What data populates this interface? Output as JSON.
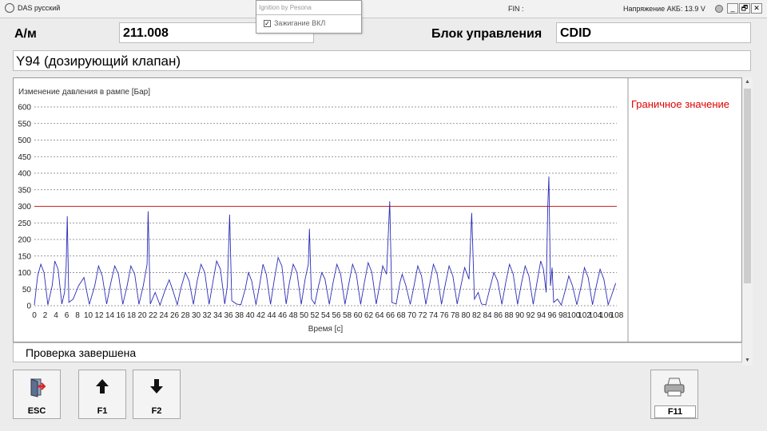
{
  "titlebar": {
    "app_title": "DAS русский",
    "fin_label": "FIN :",
    "voltage_label": "Напряжение АКБ: 13.9 V",
    "minimize_glyph": "_",
    "restore_glyph": "🗗",
    "close_glyph": "✕"
  },
  "popup": {
    "title": "Ignition by Pesona",
    "checkbox_mark": "✓",
    "checkbox_label": "Зажигание ВКЛ"
  },
  "header": {
    "am_label": "А/м",
    "am_value": "211.008",
    "ecu_label": "Блок управления",
    "ecu_value": "CDID"
  },
  "component": "Y94 (дозирующий клапан)",
  "legend_label": "Граничное значение",
  "colors": {
    "series": "#2b2bb8",
    "limit": "#cc2222",
    "legend": "#e00000"
  },
  "status_text": "Проверка завершена",
  "scrollbar": {
    "up_glyph": "▲",
    "down_glyph": "▼"
  },
  "buttons": [
    {
      "label": "ESC",
      "icon": "door-exit-icon"
    },
    {
      "label": "F1",
      "icon": "arrow-up-icon",
      "glyph": "🡅"
    },
    {
      "label": "F2",
      "icon": "arrow-down-icon",
      "glyph": "🡇"
    },
    {
      "label": "F11",
      "icon": "printer-icon"
    }
  ],
  "chart_data": {
    "type": "line",
    "title": "Изменение давления в рампе [Бар]",
    "xlabel": "Время [с]",
    "ylabel": "",
    "xlim": [
      0,
      108
    ],
    "ylim": [
      0,
      600
    ],
    "y_ticks": [
      0,
      50,
      100,
      150,
      200,
      250,
      300,
      350,
      400,
      450,
      500,
      550,
      600
    ],
    "x_ticks": [
      0,
      2,
      4,
      6,
      8,
      10,
      12,
      14,
      16,
      18,
      20,
      22,
      24,
      26,
      28,
      30,
      32,
      34,
      36,
      38,
      40,
      42,
      44,
      46,
      48,
      50,
      52,
      54,
      56,
      58,
      60,
      62,
      64,
      66,
      68,
      70,
      72,
      74,
      76,
      78,
      80,
      82,
      84,
      86,
      88,
      90,
      92,
      94,
      96,
      98,
      100,
      102,
      104,
      106,
      108
    ],
    "grid": "horizontal dashed",
    "limit_line": {
      "name": "Граничное значение",
      "value": 300
    },
    "series": [
      {
        "values": [
          [
            0,
            2
          ],
          [
            0.6,
            90
          ],
          [
            1.2,
            125
          ],
          [
            1.8,
            100
          ],
          [
            2.5,
            3
          ],
          [
            3.3,
            60
          ],
          [
            3.8,
            135
          ],
          [
            4.4,
            110
          ],
          [
            5.1,
            5
          ],
          [
            5.6,
            40
          ],
          [
            5.9,
            120
          ],
          [
            6.1,
            270
          ],
          [
            6.4,
            10
          ],
          [
            7.2,
            20
          ],
          [
            8.2,
            60
          ],
          [
            9.2,
            85
          ],
          [
            10.2,
            4
          ],
          [
            11.2,
            60
          ],
          [
            11.9,
            120
          ],
          [
            12.6,
            90
          ],
          [
            13.4,
            5
          ],
          [
            14.2,
            70
          ],
          [
            14.9,
            120
          ],
          [
            15.6,
            95
          ],
          [
            16.4,
            4
          ],
          [
            17.2,
            60
          ],
          [
            17.9,
            120
          ],
          [
            18.6,
            95
          ],
          [
            19.4,
            4
          ],
          [
            20.2,
            60
          ],
          [
            20.9,
            125
          ],
          [
            21.1,
            285
          ],
          [
            21.5,
            5
          ],
          [
            22.4,
            40
          ],
          [
            23.3,
            2
          ],
          [
            24.3,
            50
          ],
          [
            25.0,
            78
          ],
          [
            25.7,
            45
          ],
          [
            26.5,
            3
          ],
          [
            27.2,
            55
          ],
          [
            28.0,
            100
          ],
          [
            28.7,
            75
          ],
          [
            29.5,
            4
          ],
          [
            30.2,
            75
          ],
          [
            30.9,
            125
          ],
          [
            31.6,
            100
          ],
          [
            32.4,
            4
          ],
          [
            33.1,
            70
          ],
          [
            33.8,
            135
          ],
          [
            34.5,
            110
          ],
          [
            35.3,
            5
          ],
          [
            35.8,
            60
          ],
          [
            36.2,
            275
          ],
          [
            36.6,
            15
          ],
          [
            37.5,
            5
          ],
          [
            38.3,
            3
          ],
          [
            39.1,
            50
          ],
          [
            39.7,
            100
          ],
          [
            40.3,
            75
          ],
          [
            41.1,
            3
          ],
          [
            41.8,
            65
          ],
          [
            42.4,
            125
          ],
          [
            43.0,
            95
          ],
          [
            43.8,
            4
          ],
          [
            44.5,
            80
          ],
          [
            45.2,
            145
          ],
          [
            45.9,
            120
          ],
          [
            46.7,
            5
          ],
          [
            47.3,
            70
          ],
          [
            48.0,
            125
          ],
          [
            48.7,
            100
          ],
          [
            49.5,
            4
          ],
          [
            50.2,
            80
          ],
          [
            50.8,
            125
          ],
          [
            51.0,
            232
          ],
          [
            51.4,
            20
          ],
          [
            52.0,
            5
          ],
          [
            52.7,
            60
          ],
          [
            53.3,
            100
          ],
          [
            53.9,
            80
          ],
          [
            54.7,
            4
          ],
          [
            55.4,
            70
          ],
          [
            56.1,
            125
          ],
          [
            56.8,
            95
          ],
          [
            57.6,
            4
          ],
          [
            58.3,
            65
          ],
          [
            59.0,
            125
          ],
          [
            59.7,
            95
          ],
          [
            60.5,
            4
          ],
          [
            61.2,
            70
          ],
          [
            61.9,
            130
          ],
          [
            62.6,
            100
          ],
          [
            63.4,
            5
          ],
          [
            64.0,
            60
          ],
          [
            64.6,
            120
          ],
          [
            65.3,
            95
          ],
          [
            65.9,
            315
          ],
          [
            66.3,
            10
          ],
          [
            67.1,
            5
          ],
          [
            67.8,
            70
          ],
          [
            68.2,
            95
          ],
          [
            68.9,
            60
          ],
          [
            69.7,
            4
          ],
          [
            70.4,
            60
          ],
          [
            71.1,
            120
          ],
          [
            71.8,
            90
          ],
          [
            72.6,
            4
          ],
          [
            73.3,
            65
          ],
          [
            74.0,
            125
          ],
          [
            74.7,
            95
          ],
          [
            75.5,
            4
          ],
          [
            76.2,
            65
          ],
          [
            76.9,
            120
          ],
          [
            77.6,
            90
          ],
          [
            78.4,
            5
          ],
          [
            79.1,
            60
          ],
          [
            79.8,
            115
          ],
          [
            80.6,
            80
          ],
          [
            81.1,
            280
          ],
          [
            81.6,
            20
          ],
          [
            82.3,
            40
          ],
          [
            82.9,
            5
          ],
          [
            83.7,
            3
          ],
          [
            84.5,
            55
          ],
          [
            85.2,
            100
          ],
          [
            85.9,
            75
          ],
          [
            86.7,
            4
          ],
          [
            87.4,
            70
          ],
          [
            88.1,
            125
          ],
          [
            88.8,
            95
          ],
          [
            89.6,
            4
          ],
          [
            90.3,
            65
          ],
          [
            91.0,
            120
          ],
          [
            91.7,
            90
          ],
          [
            92.5,
            4
          ],
          [
            93.2,
            70
          ],
          [
            93.9,
            135
          ],
          [
            94.4,
            110
          ],
          [
            94.9,
            40
          ],
          [
            95.2,
            300
          ],
          [
            95.4,
            390
          ],
          [
            95.7,
            60
          ],
          [
            96.0,
            115
          ],
          [
            96.3,
            10
          ],
          [
            97.0,
            20
          ],
          [
            97.7,
            2
          ],
          [
            98.5,
            50
          ],
          [
            99.1,
            90
          ],
          [
            99.8,
            60
          ],
          [
            100.6,
            3
          ],
          [
            101.4,
            60
          ],
          [
            102.0,
            115
          ],
          [
            102.7,
            85
          ],
          [
            103.5,
            3
          ],
          [
            104.2,
            60
          ],
          [
            104.9,
            110
          ],
          [
            105.6,
            80
          ],
          [
            106.4,
            3
          ],
          [
            107.0,
            30
          ],
          [
            107.8,
            68
          ]
        ]
      }
    ]
  }
}
